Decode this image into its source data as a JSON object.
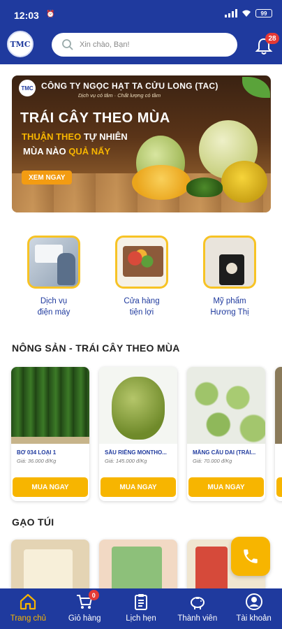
{
  "status_bar": {
    "time": "12:03",
    "battery": "99"
  },
  "header": {
    "logo_text": "TMC",
    "search_placeholder": "Xin chào, Bạn!",
    "notification_count": "28"
  },
  "banner": {
    "company": "CÔNG TY NGỌC HẠT TA CỬU LONG (TAC)",
    "slogan": "Dịch vụ có tâm · Chất lượng có tầm",
    "title": "TRÁI CÂY THEO MÙA",
    "line1_a": "THUẬN THEO",
    "line1_b": "TỰ NHIÊN",
    "line2_a": "MÙA NÀO",
    "line2_b": "QUẢ NẤY",
    "button": "XEM NGAY"
  },
  "categories": [
    {
      "label_line1": "Dịch vụ",
      "label_line2": "điện máy"
    },
    {
      "label_line1": "Cửa hàng",
      "label_line2": "tiện lợi"
    },
    {
      "label_line1": "Mỹ phẩm",
      "label_line2": "Hương Thị"
    }
  ],
  "section_seasonal": {
    "title": "NÔNG SẢN - TRÁI CÂY THEO MÙA",
    "products": [
      {
        "name": "BƠ 034 LOẠI 1",
        "price": "Giá: 36.000 đ/Kg",
        "button": "MUA NGAY"
      },
      {
        "name": "SẦU RIÊNG MONTHO...",
        "price": "Giá: 145.000 đ/Kg",
        "button": "MUA NGAY"
      },
      {
        "name": "MÃNG CẦU DAI (TRÁI...",
        "price": "Giá: 70.000 đ/Kg",
        "button": "MUA NGAY"
      }
    ]
  },
  "section_rice": {
    "title": "GẠO TÚI"
  },
  "bottom_nav": {
    "items": [
      {
        "label": "Trang chủ"
      },
      {
        "label": "Giỏ hàng",
        "badge": "0"
      },
      {
        "label": "Lịch hẹn"
      },
      {
        "label": "Thành viên"
      },
      {
        "label": "Tài khoản"
      }
    ]
  },
  "colors": {
    "primary": "#1f3a9e",
    "accent": "#f7b500",
    "badge": "#e53935"
  }
}
